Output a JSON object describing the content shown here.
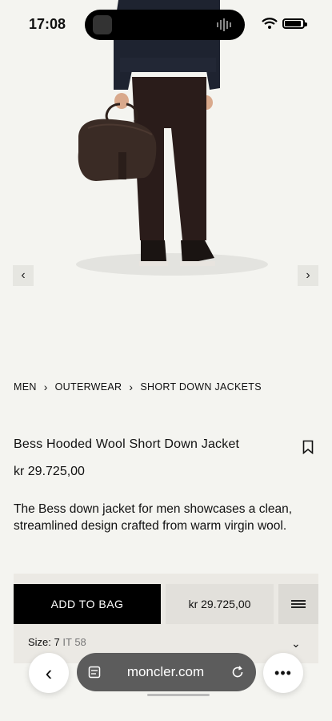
{
  "status": {
    "time": "17:08"
  },
  "hero": {
    "prev_icon": "chevron-left-icon",
    "next_icon": "chevron-right-icon"
  },
  "breadcrumb": {
    "items": [
      "MEN",
      "OUTERWEAR",
      "SHORT DOWN JACKETS"
    ],
    "separator": "›"
  },
  "product": {
    "title": "Bess Hooded Wool Short Down Jacket",
    "price": "kr 29.725,00",
    "description": "The Bess down jacket for men showcases a clean, streamlined design crafted from warm virgin wool."
  },
  "cta": {
    "add_to_bag": "ADD TO BAG",
    "price": "kr 29.725,00",
    "size_label": "Size:",
    "size_value": "7",
    "size_it": "IT 58"
  },
  "browser": {
    "url": "moncler.com"
  },
  "colors": {
    "background": "#f4f4f0",
    "button_black": "#000000",
    "url_pill": "#5c5c5c"
  }
}
